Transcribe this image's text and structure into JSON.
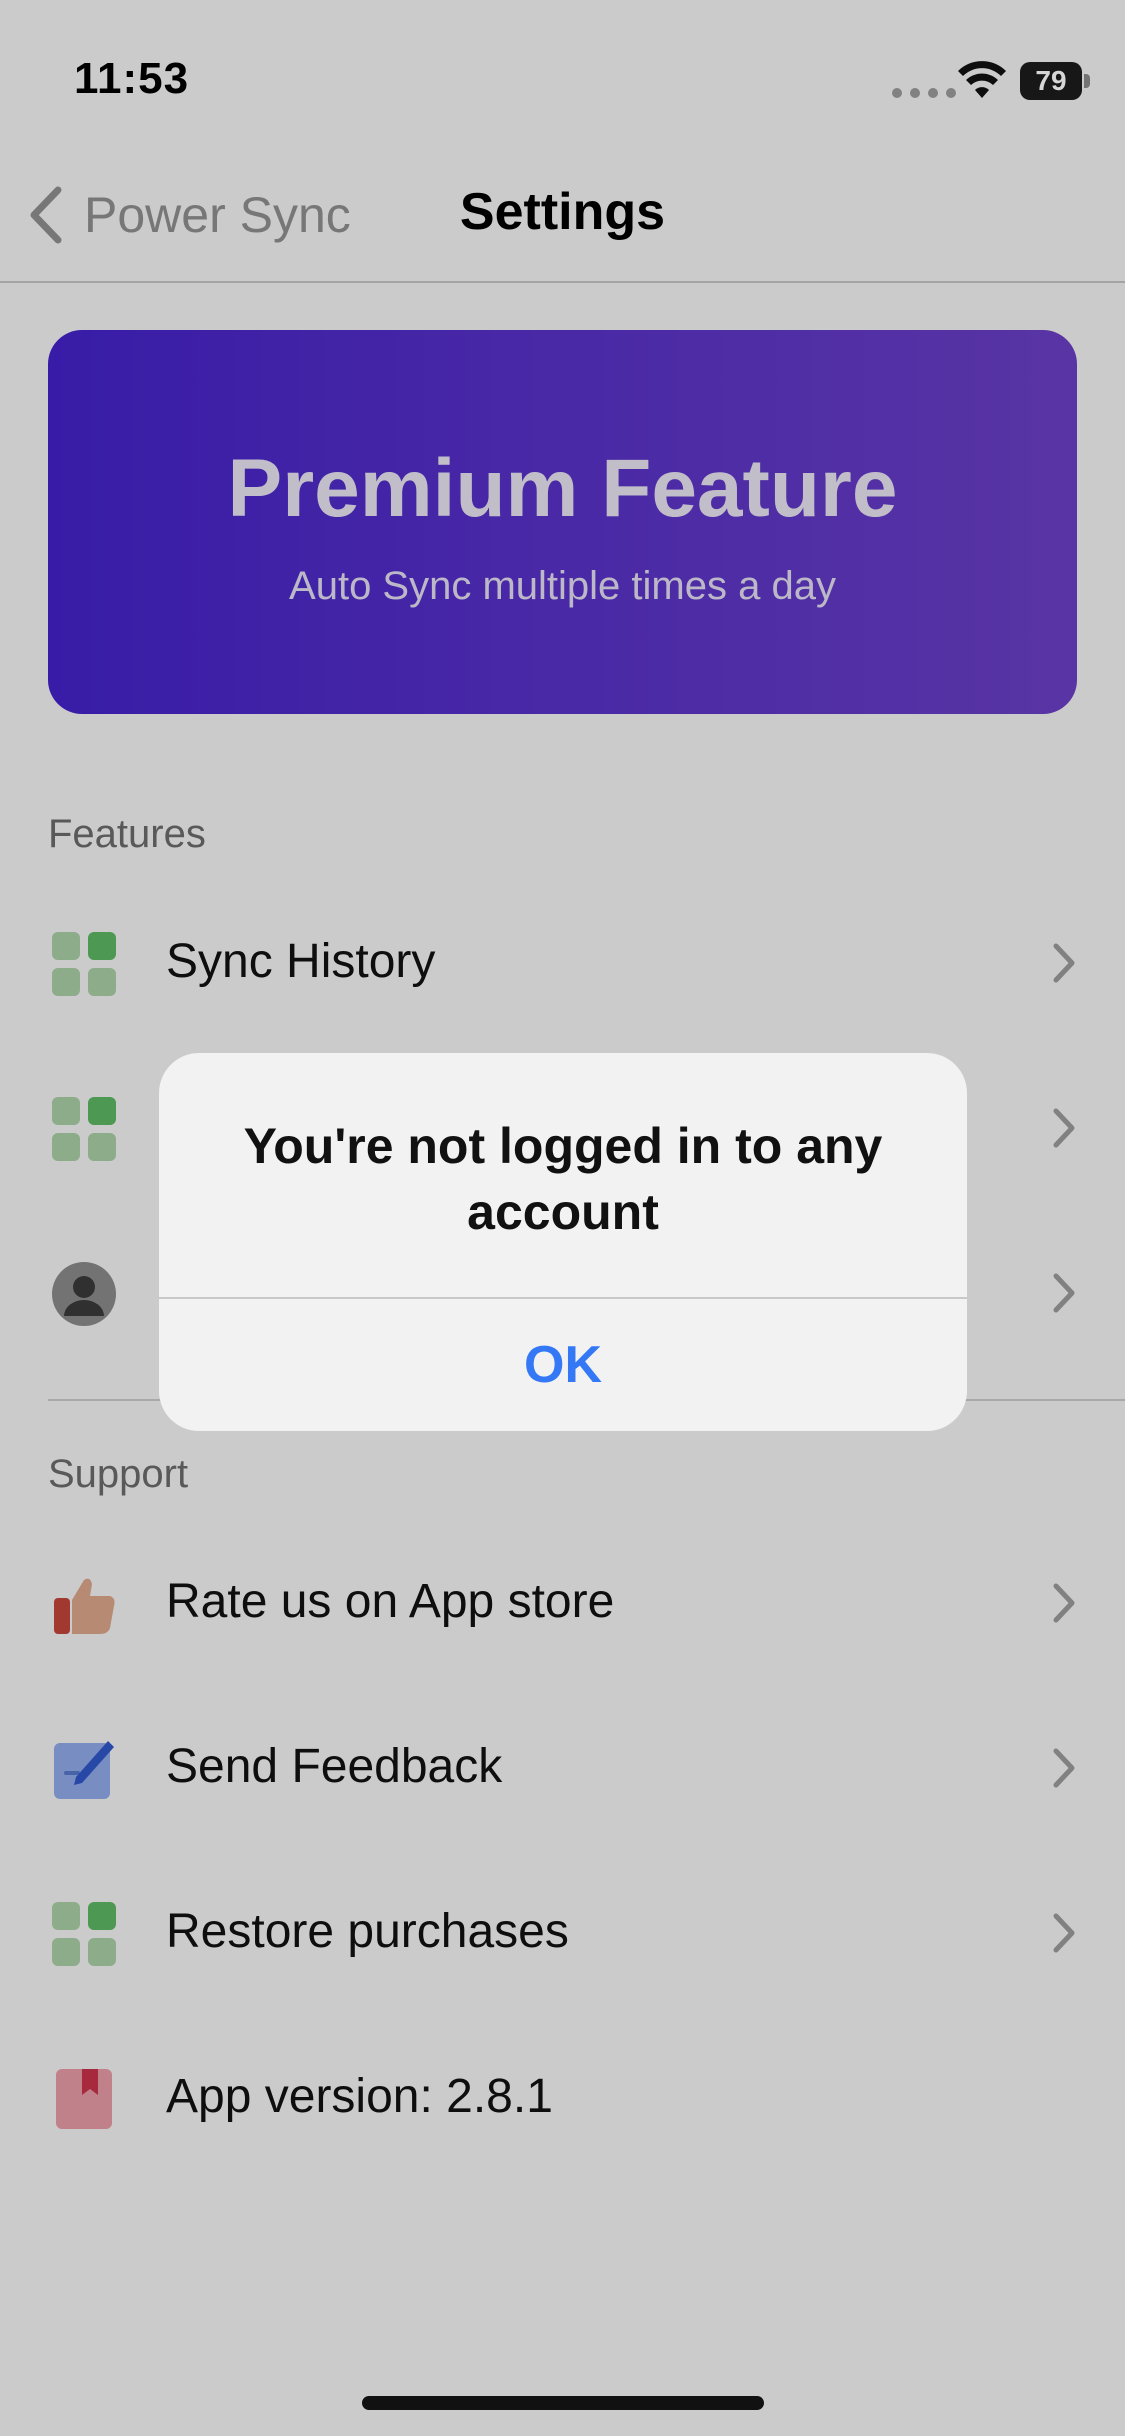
{
  "status": {
    "time": "11:53",
    "battery": "79"
  },
  "nav": {
    "back_label": "Power Sync",
    "title": "Settings"
  },
  "banner": {
    "title": "Premium Feature",
    "subtitle": "Auto Sync multiple times a day"
  },
  "features": {
    "header": "Features",
    "items": [
      {
        "label": "Sync History",
        "icon": "grid-icon"
      },
      {
        "label": "",
        "icon": "grid-icon"
      },
      {
        "label": "",
        "icon": "person-icon"
      }
    ]
  },
  "support": {
    "header": "Support",
    "items": [
      {
        "label": "Rate us on App store",
        "icon": "thumbs-up-icon"
      },
      {
        "label": "Send Feedback",
        "icon": "compose-icon"
      },
      {
        "label": "Restore purchases",
        "icon": "grid-icon"
      },
      {
        "label": "App version: 2.8.1",
        "icon": "bookmark-icon"
      }
    ]
  },
  "alert": {
    "title": "You're not logged in to any account",
    "ok_label": "OK"
  },
  "colors": {
    "accent": "#3478f6",
    "banner_start": "#4322c7",
    "banner_end": "#6a3fc4"
  }
}
